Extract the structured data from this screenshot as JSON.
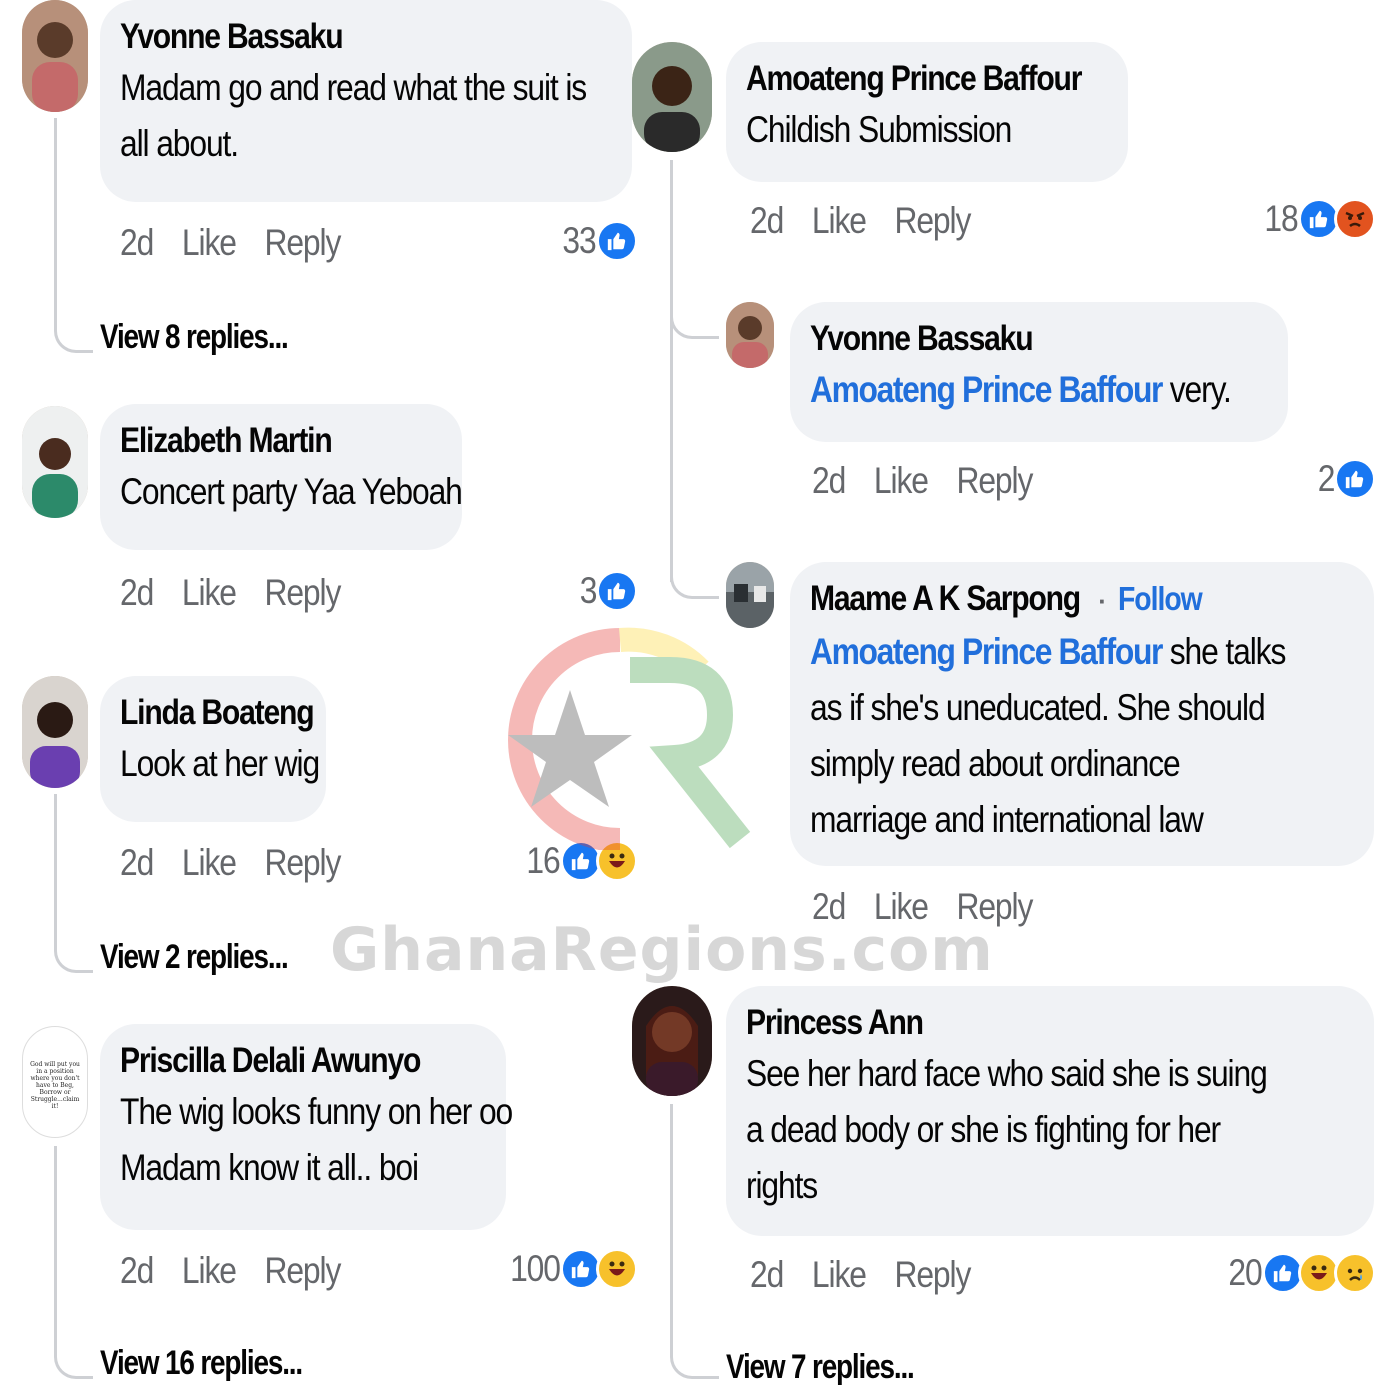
{
  "left_column": [
    {
      "author": "Yvonne Bassaku",
      "text": "Madam go and read what the suit is all about.",
      "age": "2d",
      "like_label": "Like",
      "reply_label": "Reply",
      "reaction_count": "33",
      "reactions": [
        "like"
      ],
      "view_replies": "View 8 replies..."
    },
    {
      "author": "Elizabeth Martin",
      "text": "Concert party  Yaa Yeboah",
      "age": "2d",
      "like_label": "Like",
      "reply_label": "Reply",
      "reaction_count": "3",
      "reactions": [
        "like"
      ]
    },
    {
      "author": "Linda Boateng",
      "text": "Look at her wig",
      "age": "2d",
      "like_label": "Like",
      "reply_label": "Reply",
      "reaction_count": "16",
      "reactions": [
        "like",
        "haha"
      ],
      "view_replies": "View 2 replies..."
    },
    {
      "author": "Priscilla Delali Awunyo",
      "text_line1": "The wig looks funny on her oo",
      "text_line2": "Madam know it all.. boi",
      "avatar_text": "God will put you in a position where you don't have to Beg, Borrow or Struggle...claim it!",
      "age": "2d",
      "like_label": "Like",
      "reply_label": "Reply",
      "reaction_count": "100",
      "reactions": [
        "like",
        "haha"
      ],
      "view_replies": "View 16 replies..."
    }
  ],
  "right_column": [
    {
      "author": "Amoateng Prince Baffour",
      "text": "Childish Submission",
      "age": "2d",
      "like_label": "Like",
      "reply_label": "Reply",
      "reaction_count": "18",
      "reactions": [
        "like",
        "angry"
      ]
    },
    {
      "author": "Yvonne Bassaku",
      "mention": "Amoateng Prince Baffour",
      "text": " very.",
      "age": "2d",
      "like_label": "Like",
      "reply_label": "Reply",
      "reaction_count": "2",
      "reactions": [
        "like"
      ]
    },
    {
      "author": "Maame A K Sarpong",
      "separator": "·",
      "follow_label": "Follow",
      "mention": "Amoateng Prince Baffour",
      "text_line1_rest": " she talks",
      "text_line2": "as if she's uneducated.  She should",
      "text_line3": "simply read about ordinance",
      "text_line4": "marriage and international law",
      "age": "2d",
      "like_label": "Like",
      "reply_label": "Reply"
    },
    {
      "author": "Princess Ann",
      "text_line1": "See her hard face who said she is suing",
      "text_line2": "a dead body or she is fighting for her",
      "text_line3": "rights",
      "age": "2d",
      "like_label": "Like",
      "reply_label": "Reply",
      "reaction_count": "20",
      "reactions": [
        "like",
        "haha",
        "sad"
      ],
      "view_replies": "View 7 replies..."
    }
  ],
  "watermark": {
    "site": "GhanaRegions.com",
    "logo_letters": "GR"
  },
  "colors": {
    "bubble": "#f0f2f5",
    "link_blue": "#216fdb",
    "like_blue": "#1877f2",
    "meta_gray": "#65676b"
  }
}
